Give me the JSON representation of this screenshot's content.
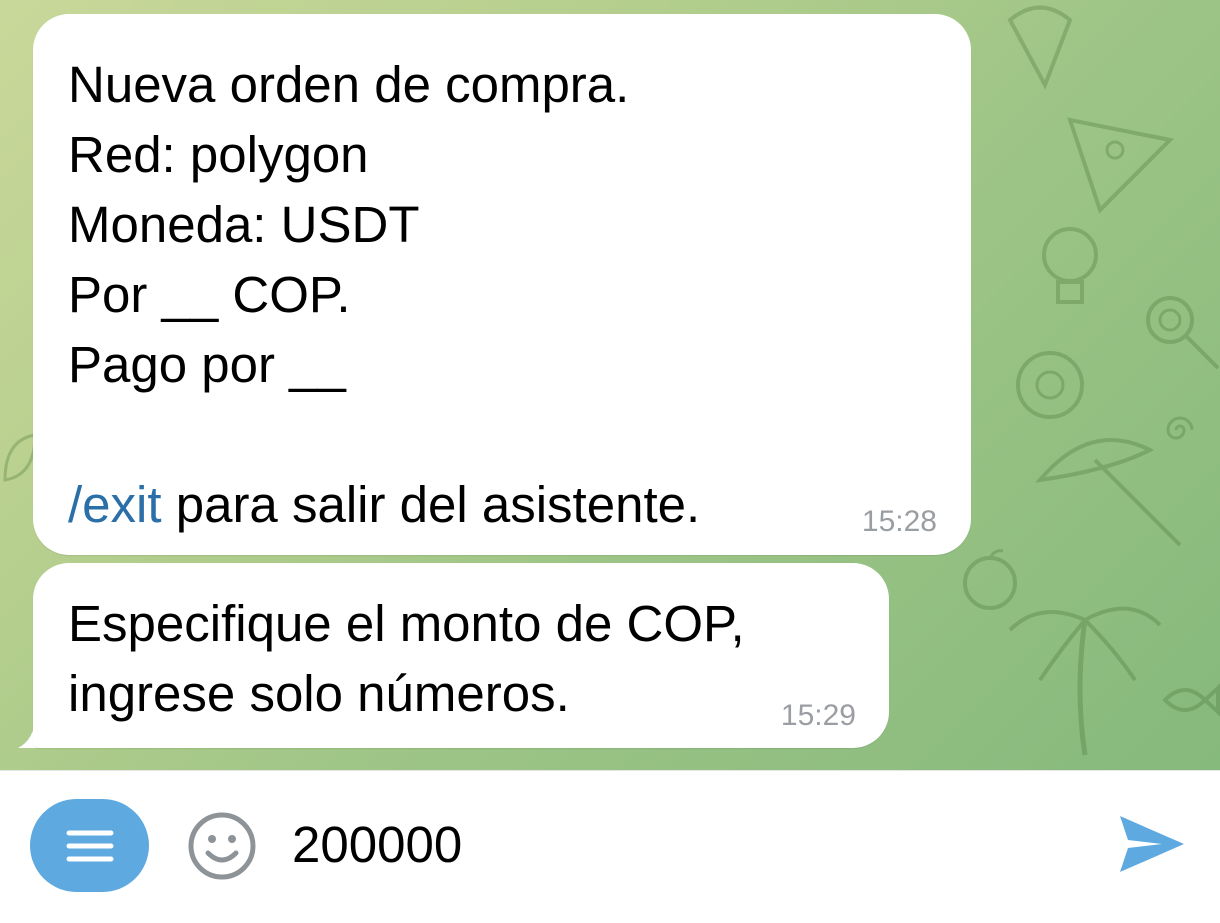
{
  "messages": [
    {
      "lines": "Nueva orden de compra.\nRed: polygon\nMoneda: USDT\nPor __ COP.\nPago por __\n\n",
      "command": "/exit",
      "command_suffix": " para salir del asistente.",
      "time": "15:28"
    },
    {
      "lines": "Especifique el monto de COP,\ningrese solo números.",
      "time": "15:29"
    }
  ],
  "composer": {
    "value": "200000",
    "menu_icon": "menu-icon",
    "emoji_icon": "emoji-icon",
    "send_icon": "send-icon"
  },
  "colors": {
    "menu_button": "#5ea9df",
    "send_icon": "#5ea9df",
    "link": "#2a6fa8",
    "timestamp": "#9a9ea3"
  }
}
